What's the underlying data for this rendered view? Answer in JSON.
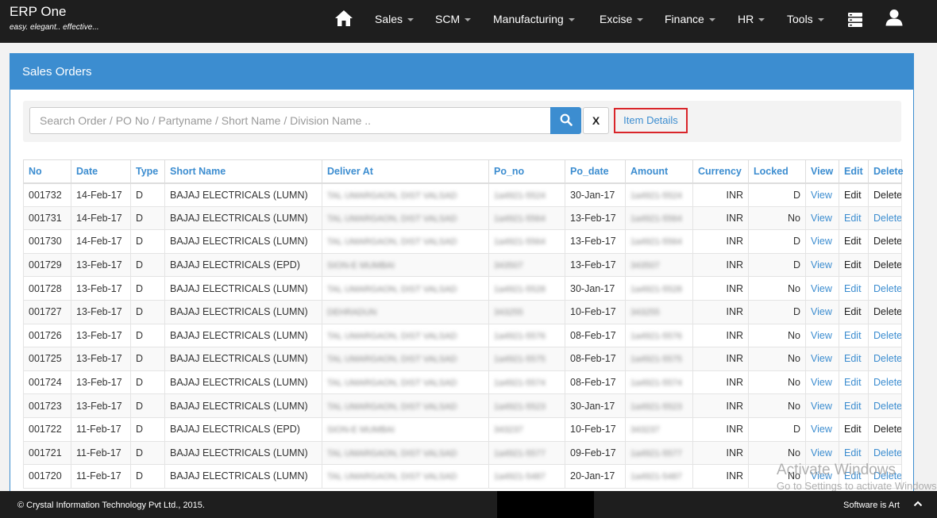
{
  "app": {
    "name": "ERP One",
    "tagline": "easy. elegant.. effective..."
  },
  "nav": {
    "home_icon": "home-icon",
    "items": [
      "Sales",
      "SCM",
      "Manufacturing",
      "Excise",
      "Finance",
      "HR",
      "Tools"
    ],
    "server_icon": "server-icon",
    "user_icon": "user-icon"
  },
  "panel": {
    "title": "Sales Orders"
  },
  "search": {
    "placeholder": "Search Order / PO No / Partyname / Short Name / Division Name ..",
    "value": "",
    "search_icon": "search-icon",
    "clear_label": "X",
    "item_details_label": "Item Details"
  },
  "table": {
    "headers": [
      "No",
      "Date",
      "Type",
      "Short Name",
      "Deliver At",
      "Po_no",
      "Po_date",
      "Amount",
      "Currency",
      "Locked",
      "View",
      "Edit",
      "Delete"
    ],
    "rows": [
      {
        "no": "001732",
        "date": "14-Feb-17",
        "type": "D",
        "short": "BAJAJ ELECTRICALS (LUMN)",
        "deliver": "TAL UMARGAON, DIST VALSAD",
        "po_no": "1a4921-5524",
        "po_date": "30-Jan-17",
        "amount": "1a4921-5524",
        "currency": "INR",
        "locked": "D",
        "view": "View",
        "edit": "Edit",
        "del": "Delete"
      },
      {
        "no": "001731",
        "date": "14-Feb-17",
        "type": "D",
        "short": "BAJAJ ELECTRICALS (LUMN)",
        "deliver": "TAL UMARGAON, DIST VALSAD",
        "po_no": "1a4921-5564",
        "po_date": "13-Feb-17",
        "amount": "1a4921-5564",
        "currency": "INR",
        "locked": "No",
        "view": "View",
        "edit": "Edit",
        "del": "Delete"
      },
      {
        "no": "001730",
        "date": "14-Feb-17",
        "type": "D",
        "short": "BAJAJ ELECTRICALS (LUMN)",
        "deliver": "TAL UMARGAON, DIST VALSAD",
        "po_no": "1a4921-5564",
        "po_date": "13-Feb-17",
        "amount": "1a4921-5564",
        "currency": "INR",
        "locked": "D",
        "view": "View",
        "edit": "Edit",
        "del": "Delete"
      },
      {
        "no": "001729",
        "date": "13-Feb-17",
        "type": "D",
        "short": "BAJAJ ELECTRICALS (EPD)",
        "deliver": "SION-E MUMBAI",
        "po_no": "343507",
        "po_date": "13-Feb-17",
        "amount": "343507",
        "currency": "INR",
        "locked": "D",
        "view": "View",
        "edit": "Edit",
        "del": "Delete"
      },
      {
        "no": "001728",
        "date": "13-Feb-17",
        "type": "D",
        "short": "BAJAJ ELECTRICALS (LUMN)",
        "deliver": "TAL UMARGAON, DIST VALSAD",
        "po_no": "1a4921-5528",
        "po_date": "30-Jan-17",
        "amount": "1a4921-5528",
        "currency": "INR",
        "locked": "No",
        "view": "View",
        "edit": "Edit",
        "del": "Delete"
      },
      {
        "no": "001727",
        "date": "13-Feb-17",
        "type": "D",
        "short": "BAJAJ ELECTRICALS (LUMN)",
        "deliver": "DEHRADUN",
        "po_no": "343255",
        "po_date": "10-Feb-17",
        "amount": "343255",
        "currency": "INR",
        "locked": "D",
        "view": "View",
        "edit": "Edit",
        "del": "Delete"
      },
      {
        "no": "001726",
        "date": "13-Feb-17",
        "type": "D",
        "short": "BAJAJ ELECTRICALS (LUMN)",
        "deliver": "TAL UMARGAON, DIST VALSAD",
        "po_no": "1a4921-5576",
        "po_date": "08-Feb-17",
        "amount": "1a4921-5576",
        "currency": "INR",
        "locked": "No",
        "view": "View",
        "edit": "Edit",
        "del": "Delete"
      },
      {
        "no": "001725",
        "date": "13-Feb-17",
        "type": "D",
        "short": "BAJAJ ELECTRICALS (LUMN)",
        "deliver": "TAL UMARGAON, DIST VALSAD",
        "po_no": "1a4921-5575",
        "po_date": "08-Feb-17",
        "amount": "1a4921-5575",
        "currency": "INR",
        "locked": "No",
        "view": "View",
        "edit": "Edit",
        "del": "Delete"
      },
      {
        "no": "001724",
        "date": "13-Feb-17",
        "type": "D",
        "short": "BAJAJ ELECTRICALS (LUMN)",
        "deliver": "TAL UMARGAON, DIST VALSAD",
        "po_no": "1a4921-5574",
        "po_date": "08-Feb-17",
        "amount": "1a4921-5574",
        "currency": "INR",
        "locked": "No",
        "view": "View",
        "edit": "Edit",
        "del": "Delete"
      },
      {
        "no": "001723",
        "date": "13-Feb-17",
        "type": "D",
        "short": "BAJAJ ELECTRICALS (LUMN)",
        "deliver": "TAL UMARGAON, DIST VALSAD",
        "po_no": "1a4921-5523",
        "po_date": "30-Jan-17",
        "amount": "1a4921-5523",
        "currency": "INR",
        "locked": "No",
        "view": "View",
        "edit": "Edit",
        "del": "Delete"
      },
      {
        "no": "001722",
        "date": "11-Feb-17",
        "type": "D",
        "short": "BAJAJ ELECTRICALS (EPD)",
        "deliver": "SION-E MUMBAI",
        "po_no": "343237",
        "po_date": "10-Feb-17",
        "amount": "343237",
        "currency": "INR",
        "locked": "D",
        "view": "View",
        "edit": "Edit",
        "del": "Delete"
      },
      {
        "no": "001721",
        "date": "11-Feb-17",
        "type": "D",
        "short": "BAJAJ ELECTRICALS (LUMN)",
        "deliver": "TAL UMARGAON, DIST VALSAD",
        "po_no": "1a4921-5577",
        "po_date": "09-Feb-17",
        "amount": "1a4921-5577",
        "currency": "INR",
        "locked": "No",
        "view": "View",
        "edit": "Edit",
        "del": "Delete"
      },
      {
        "no": "001720",
        "date": "11-Feb-17",
        "type": "D",
        "short": "BAJAJ ELECTRICALS (LUMN)",
        "deliver": "TAL UMARGAON, DIST VALSAD",
        "po_no": "1a4921-5487",
        "po_date": "20-Jan-17",
        "amount": "1a4921-5487",
        "currency": "INR",
        "locked": "No",
        "view": "View",
        "edit": "Edit",
        "del": "Delete"
      }
    ]
  },
  "footer": {
    "copyright": "© Crystal Information Technology Pvt Ltd., 2015.",
    "slogan": "Software is Art",
    "up_icon": "chevron-up-icon"
  },
  "watermark": {
    "line1": "Activate Windows",
    "line2": "Go to Settings to activate Windows."
  },
  "colors": {
    "accent": "#3c8dd0",
    "topbar": "#1e1e1e",
    "highlight": "#d9252a"
  }
}
